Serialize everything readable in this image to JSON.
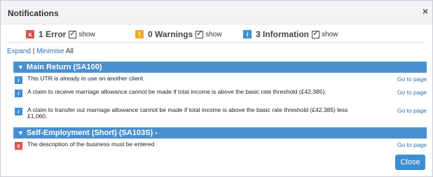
{
  "dialog": {
    "title": "Notifications",
    "close_glyph": "×",
    "close_button_label": "Close"
  },
  "summary": {
    "error": {
      "icon": "error-icon",
      "label": "1 Error",
      "show_label": "show",
      "checked": true
    },
    "warnings": {
      "icon": "warning-icon",
      "label": "0 Warnings",
      "show_label": "show",
      "checked": true
    },
    "information": {
      "icon": "info-icon",
      "label": "3 Information",
      "show_label": "show",
      "checked": true
    }
  },
  "controls": {
    "expand": "Expand",
    "separator": "|",
    "minimise": "Minimise",
    "all": "All"
  },
  "sections": [
    {
      "title": "Main Return (SA100)",
      "messages": [
        {
          "type": "info",
          "text": "This UTR is already in use on another client.",
          "link": "Go to page"
        },
        {
          "type": "info",
          "text": "A claim to receive marriage allowance cannot be made if total income is above the basic rate threshold (£42,385).",
          "link": "Go to page"
        },
        {
          "type": "info",
          "text": "A claim to transfer out marriage allowance cannot be made if total income is above the basic rate threshold (£42,385) less £1,060.",
          "link": "Go to page"
        }
      ]
    },
    {
      "title": "Self-Employment (Short) (SA103S) -",
      "messages": [
        {
          "type": "error",
          "text": "The description of the business must be entered",
          "link": "Go to page"
        }
      ]
    }
  ],
  "colors": {
    "section_bar": "#4a90cf",
    "error": "#d9534f",
    "warning": "#f0a92c",
    "info": "#3d8fd1",
    "link": "#2a6fb0"
  }
}
